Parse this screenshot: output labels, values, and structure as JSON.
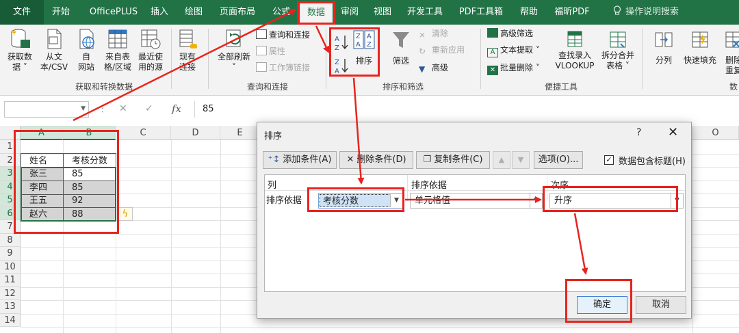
{
  "ribbon": {
    "tabs": [
      {
        "label": "文件",
        "active": false
      },
      {
        "label": "开始",
        "active": false
      },
      {
        "label": "OfficePLUS",
        "active": false
      },
      {
        "label": "插入",
        "active": false
      },
      {
        "label": "绘图",
        "active": false
      },
      {
        "label": "页面布局",
        "active": false
      },
      {
        "label": "公式",
        "active": false
      },
      {
        "label": "数据",
        "active": true
      },
      {
        "label": "审阅",
        "active": false
      },
      {
        "label": "视图",
        "active": false
      },
      {
        "label": "开发工具",
        "active": false
      },
      {
        "label": "PDF工具箱",
        "active": false
      },
      {
        "label": "帮助",
        "active": false
      },
      {
        "label": "福昕PDF",
        "active": false
      }
    ],
    "search_label": "操作说明搜索",
    "groups": {
      "get_transform": {
        "label": "获取和转换数据",
        "buttons": [
          {
            "line1": "获取数",
            "line2": "据 ˅"
          },
          {
            "line1": "从文",
            "line2": "本/CSV"
          },
          {
            "line1": "自",
            "line2": "网站"
          },
          {
            "line1": "来自表",
            "line2": "格/区域"
          },
          {
            "line1": "最近使",
            "line2": "用的源"
          },
          {
            "line1": "现有",
            "line2": "连接"
          }
        ]
      },
      "queries": {
        "label": "查询和连接",
        "refresh": {
          "line1": "全部刷新",
          "line2": "˅"
        },
        "items": [
          "查询和连接",
          "属性",
          "工作簿链接"
        ]
      },
      "sort_filter": {
        "label": "排序和筛选",
        "sort": "排序",
        "filter": "筛选",
        "clear": "清除",
        "reapply": "重新应用",
        "advanced": "高级"
      },
      "quick_tools": {
        "label": "便捷工具",
        "items": [
          "高级筛选",
          "文本提取 ˅",
          "批量删除 ˅"
        ],
        "lookup": {
          "line1": "查找录入",
          "line2": "VLOOKUP"
        },
        "split": {
          "line1": "拆分合并",
          "line2": "表格 ˅"
        }
      },
      "data_tools": {
        "label": "数",
        "split_col": "分列",
        "flash_fill": "快速填充",
        "remove_dup": {
          "line1": "删除",
          "line2": "重复"
        }
      }
    }
  },
  "formula_bar": {
    "name_box": "",
    "fx": "fx",
    "value": "85"
  },
  "sheet": {
    "columns": [
      "A",
      "B",
      "C",
      "D",
      "E",
      "O"
    ],
    "rows": [
      "1",
      "2",
      "3",
      "4",
      "5",
      "6",
      "7",
      "8",
      "9",
      "10",
      "11",
      "12",
      "13",
      "14"
    ],
    "header": {
      "name": "姓名",
      "score": "考核分数"
    },
    "data": [
      {
        "name": "张三",
        "score": "85"
      },
      {
        "name": "李四",
        "score": "85"
      },
      {
        "name": "王五",
        "score": "92"
      },
      {
        "name": "赵六",
        "score": "88"
      }
    ]
  },
  "dialog": {
    "title": "排序",
    "help": "?",
    "close": "✕",
    "add_condition": "添加条件(A)",
    "delete_condition": "删除条件(D)",
    "copy_condition": "复制条件(C)",
    "options": "选项(O)...",
    "has_header": "数据包含标题(H)",
    "has_header_checked": true,
    "col_header": "列",
    "sort_on_header": "排序依据",
    "order_header": "次序",
    "row_label": "排序依据",
    "column_value": "考核分数",
    "sort_on_value": "单元格值",
    "order_value": "升序",
    "ok": "确定",
    "cancel": "取消"
  },
  "colors": {
    "excel_green": "#217346",
    "annotation_red": "#e8231d"
  }
}
